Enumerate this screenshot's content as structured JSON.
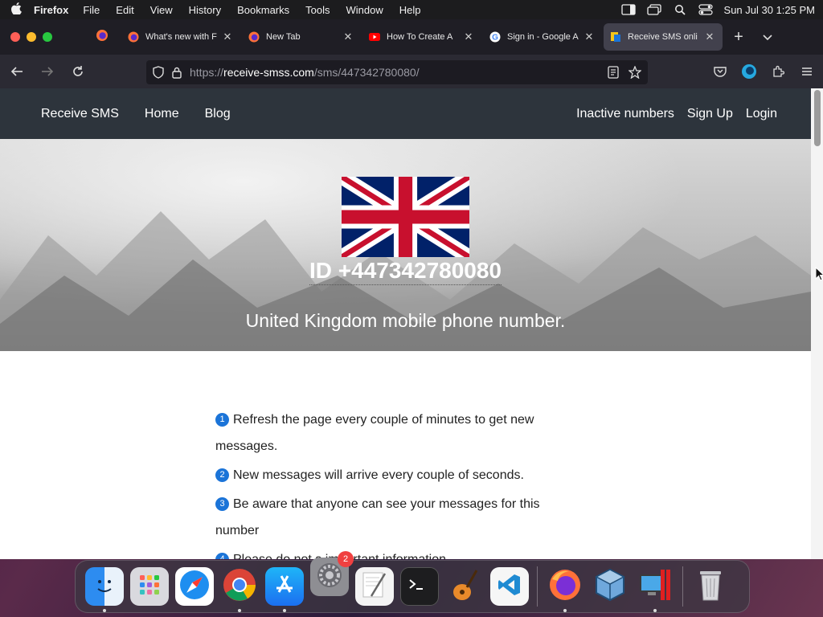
{
  "menubar": {
    "app_name": "Firefox",
    "items": [
      "File",
      "Edit",
      "View",
      "History",
      "Bookmarks",
      "Tools",
      "Window",
      "Help"
    ],
    "datetime": "Sun Jul 30  1:25 PM"
  },
  "tabs": [
    {
      "title": "What's new with F",
      "favicon": "firefox-icon"
    },
    {
      "title": "New Tab",
      "favicon": "firefox-icon"
    },
    {
      "title": "How To Create A",
      "favicon": "youtube-icon"
    },
    {
      "title": "Sign in - Google A",
      "favicon": "google-icon"
    },
    {
      "title": "Receive SMS onli",
      "favicon": "receive-sms-icon",
      "active": true
    }
  ],
  "url": {
    "prefix": "https://",
    "host": "receive-smss.com",
    "path": "/sms/447342780080/"
  },
  "site": {
    "brand": "Receive SMS",
    "nav_left": [
      "Home",
      "Blog"
    ],
    "nav_right": [
      "Inactive numbers",
      "Sign Up",
      "Login"
    ],
    "hero_id": "ID +447342780080",
    "hero_subtitle": "United Kingdom mobile phone number.",
    "steps": [
      {
        "num": "1",
        "text": "Refresh the page every couple of minutes to get new messages."
      },
      {
        "num": "2",
        "text": "New messages will arrive every couple of seconds."
      },
      {
        "num": "3",
        "text": "Be aware that anyone can see your messages for this number"
      },
      {
        "num": "4",
        "text": "Please do not s  important information"
      }
    ]
  },
  "dock": {
    "apps": [
      "Finder",
      "Launchpad",
      "Safari",
      "Chrome",
      "App Store",
      "System Settings",
      "TextEdit",
      "Terminal",
      "GarageBand",
      "VS Code",
      "Firefox",
      "VirtualBox",
      "Parallels",
      "Trash"
    ],
    "settings_badge": "2"
  },
  "colors": {
    "site_nav_bg": "#2d343c",
    "step_badge": "#1b74d8",
    "tab_active": "#42414d"
  }
}
